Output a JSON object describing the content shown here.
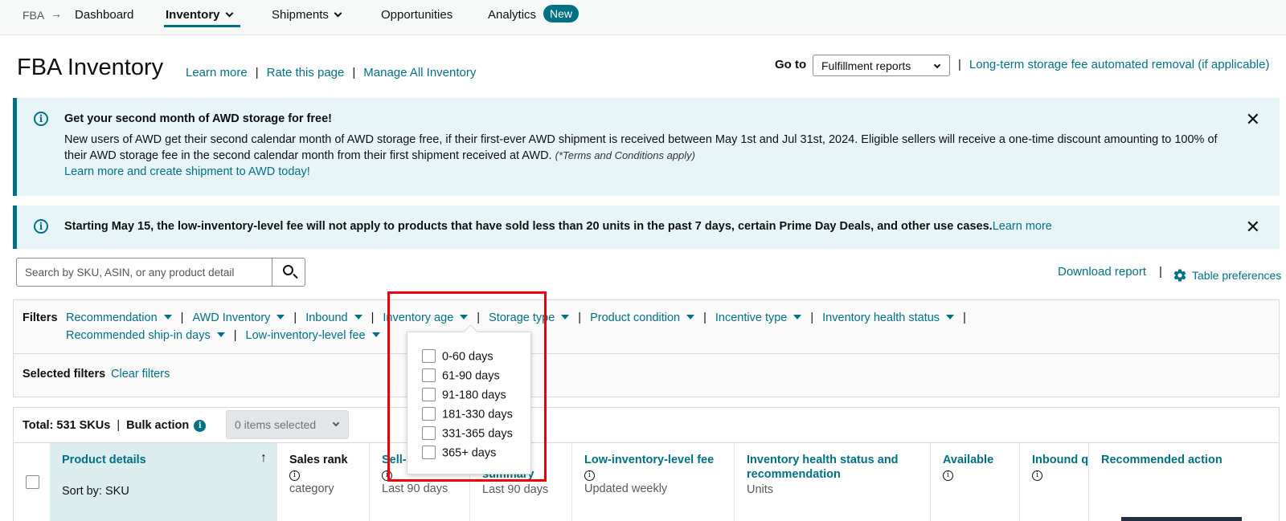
{
  "nav": {
    "root": "FBA",
    "items": [
      "Dashboard",
      "Inventory",
      "Shipments",
      "Opportunities",
      "Analytics"
    ],
    "new_badge": "New"
  },
  "header": {
    "title": "FBA Inventory",
    "links": [
      "Learn more",
      "Rate this page",
      "Manage All Inventory"
    ],
    "goto_label": "Go to",
    "goto_select": "Fulfillment reports",
    "ltsf_link": "Long-term storage fee automated removal (if applicable)"
  },
  "alert1": {
    "title": "Get your second month of AWD storage for free!",
    "body": "New users of AWD get their second calendar month of AWD storage free, if their first-ever AWD shipment is received between May 1st and Jul 31st, 2024. Eligible sellers will receive a one-time discount amounting to 100% of their AWD storage fee in the second calendar month from their first shipment received at AWD.",
    "terms": "(*Terms and Conditions apply)",
    "link": "Learn more and create shipment to AWD today!"
  },
  "alert2": {
    "text": "Starting May 15, the low-inventory-level fee will not apply to products that have sold less than 20 units in the past 7 days, certain Prime Day Deals, and other use cases.",
    "link": "Learn more"
  },
  "search": {
    "placeholder": "Search by SKU, ASIN, or any product detail"
  },
  "tools": {
    "download": "Download report",
    "table_prefs": "Table preferences"
  },
  "filters": {
    "label": "Filters",
    "row1": [
      "Recommendation",
      "AWD Inventory",
      "Inbound",
      "Inventory age",
      "Storage type",
      "Product condition",
      "Incentive type",
      "Inventory health status"
    ],
    "row2": [
      "Recommended ship-in days",
      "Low-inventory-level fee"
    ],
    "selected_label": "Selected filters",
    "clear": "Clear filters"
  },
  "inventory_age_options": [
    "0-60 days",
    "61-90 days",
    "91-180 days",
    "181-330 days",
    "331-365 days",
    "365+ days"
  ],
  "summary": {
    "total": "Total: 531 SKUs",
    "bulk": "Bulk action",
    "items_selected": "0 items selected"
  },
  "columns": {
    "product": {
      "title": "Product details",
      "sort": "Sort by: SKU"
    },
    "sales_rank": {
      "title": "Sales rank",
      "sub": "category"
    },
    "sell": {
      "title": "Sell-",
      "sub": "Last 90 days"
    },
    "summary": {
      "title": "summary",
      "sub": "Last 90 days"
    },
    "lilf": {
      "title": "Low-inventory-level fee",
      "sub": "Updated weekly"
    },
    "health": {
      "title": "Inventory health status and recommendation",
      "sub": "Units"
    },
    "available": {
      "title": "Available"
    },
    "inbound": {
      "title": "Inbound q"
    },
    "action": {
      "title": "Recommended action"
    }
  }
}
